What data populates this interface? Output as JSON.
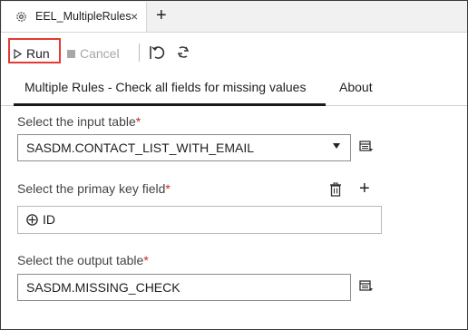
{
  "window": {
    "tab_title": "EEL_MultipleRules",
    "close_label": "×",
    "add_label": "+"
  },
  "toolbar": {
    "run_label": "Run",
    "cancel_label": "Cancel",
    "highlight_color": "#e53935"
  },
  "subtabs": [
    {
      "label": "Multiple Rules - Check all fields for missing values",
      "active": true
    },
    {
      "label": "About",
      "active": false
    }
  ],
  "form": {
    "input_table": {
      "label": "Select the input table",
      "required_mark": "*",
      "value": "SASDM.CONTACT_LIST_WITH_EMAIL"
    },
    "primary_key": {
      "label": "Select the primay key field",
      "required_mark": "*",
      "items": [
        "ID"
      ]
    },
    "output_table": {
      "label": "Select the output table",
      "required_mark": "*",
      "value": "SASDM.MISSING_CHECK"
    }
  },
  "icons": [
    "gear-icon",
    "close-icon",
    "add-tab-icon",
    "run-icon",
    "cancel-icon",
    "undo-icon",
    "refresh-icon",
    "dropdown-caret-icon",
    "browse-table-icon",
    "trash-icon",
    "add-icon",
    "key-column-icon"
  ]
}
